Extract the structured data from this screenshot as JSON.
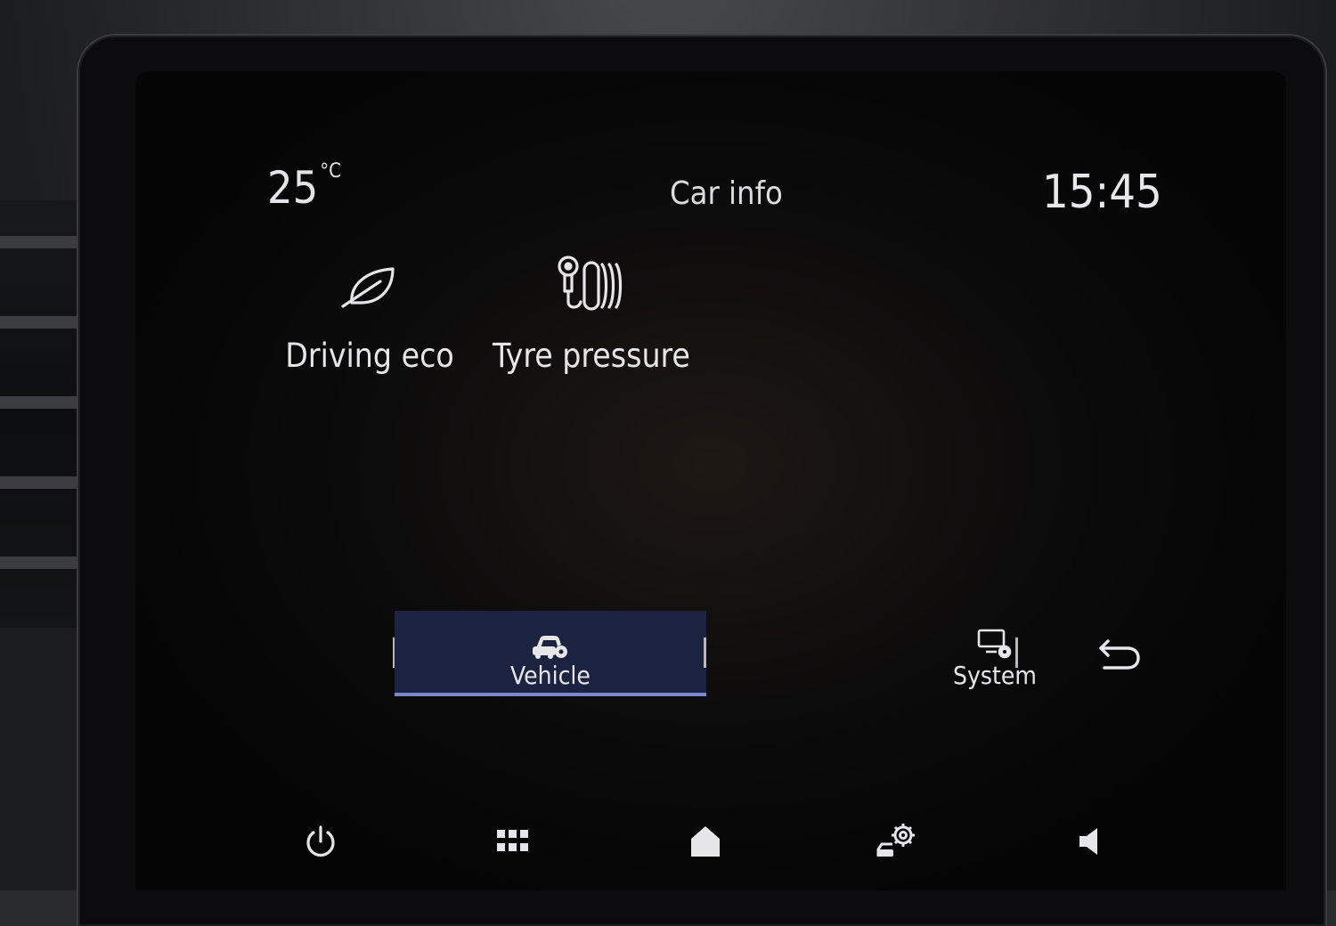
{
  "status": {
    "temperature": "25",
    "temperature_unit": "°C",
    "title": "Car info",
    "clock": "15:45"
  },
  "tiles": [
    {
      "label": "Driving eco",
      "icon": "leaf-icon"
    },
    {
      "label": "Tyre pressure",
      "icon": "tyre-pressure-icon"
    }
  ],
  "tabs": [
    {
      "label": "Vehicle",
      "icon": "car-gear-icon",
      "active": true
    },
    {
      "label": "System",
      "icon": "screen-gear-icon",
      "active": false
    }
  ],
  "nav": [
    {
      "name": "power",
      "icon": "power-icon"
    },
    {
      "name": "apps",
      "icon": "grid-icon"
    },
    {
      "name": "home",
      "icon": "home-icon"
    },
    {
      "name": "car-settings",
      "icon": "car-settings-icon"
    },
    {
      "name": "volume",
      "icon": "speaker-icon"
    }
  ],
  "colors": {
    "active_tab_bg": "#1b2340",
    "active_tab_underline": "#7b86cf",
    "text": "#e6e6e8"
  }
}
